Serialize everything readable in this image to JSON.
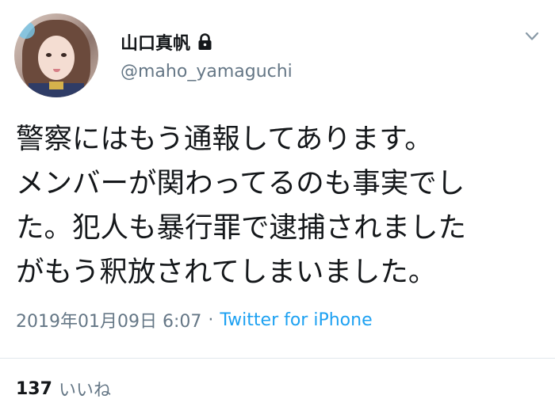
{
  "user": {
    "display_name": "山口真帆",
    "handle": "@maho_yamaguchi",
    "protected_icon": "lock-icon",
    "menu_icon": "chevron-down-icon"
  },
  "tweet": {
    "text_lines": [
      "警察にはもう通報してあります。",
      "メンバーが関わってるのも事実でし",
      "た。犯人も暴行罪で逮捕されました",
      "がもう釈放されてしまいました。"
    ],
    "timestamp": "2019年01月09日 6:07",
    "separator": "·",
    "source": "Twitter for iPhone"
  },
  "stats": {
    "likes_count": "137",
    "likes_label": "いいね"
  },
  "colors": {
    "text": "#14171a",
    "secondary": "#657786",
    "link": "#1da1f2",
    "divider": "#e1e8ed"
  }
}
